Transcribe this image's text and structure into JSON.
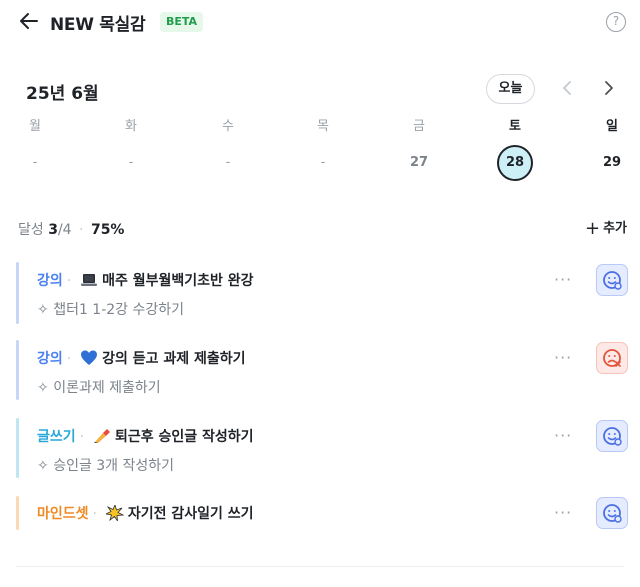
{
  "header": {
    "title": "NEW 목실감",
    "badge": "BETA",
    "help_label": "?"
  },
  "calendar": {
    "month_label": "25년 6월",
    "today_label": "오늘",
    "weekdays": [
      "월",
      "화",
      "수",
      "목",
      "금",
      "토",
      "일"
    ],
    "days": [
      "-",
      "-",
      "-",
      "-",
      "27",
      "28",
      "29"
    ],
    "selected_day": "28"
  },
  "summary": {
    "label": "달성",
    "done": "3",
    "total": "/4",
    "separator": "·",
    "percent": "75%",
    "progress": 0.75
  },
  "add_label": "추가",
  "tasks": [
    {
      "category": "강의",
      "category_color": "#4a80f0",
      "bar_color": "#c7d6f8",
      "emoji": "laptop-icon",
      "title": "매주 월부월백기초반 완강",
      "sub": "챕터1 1-2강 수강하기",
      "mood": "happy"
    },
    {
      "category": "강의",
      "category_color": "#4a80f0",
      "bar_color": "#c7d6f8",
      "emoji": "blue-heart-icon",
      "title": "강의 듣고 과제 제출하기",
      "sub": "이론과제 제출하기",
      "mood": "sad"
    },
    {
      "category": "글쓰기",
      "category_color": "#2aa8d8",
      "bar_color": "#bfe6f3",
      "emoji": "writing-hand-icon",
      "title": "퇴근후 승인글 작성하기",
      "sub": "승인글 3개 작성하기",
      "mood": "happy"
    },
    {
      "category": "마인드셋",
      "category_color": "#f08a24",
      "bar_color": "#fbd9b3",
      "emoji": "sparkle-burst-icon",
      "title": "자기전 감사일기 쓰기",
      "sub": "",
      "mood": "happy"
    }
  ],
  "more_label": "···",
  "colors": {
    "mood_happy": "#4a6fe3",
    "mood_sad": "#e0533d",
    "today_fill": "#cdeff6"
  }
}
